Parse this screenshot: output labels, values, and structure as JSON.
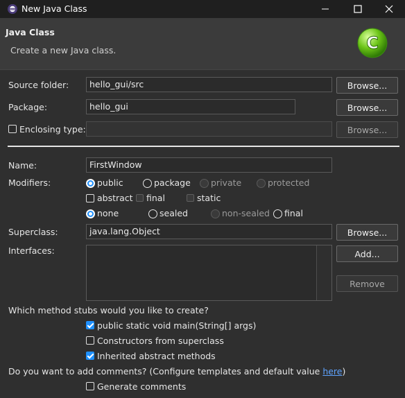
{
  "window": {
    "title": "New Java Class",
    "controls": {
      "minimize": "minimize-icon",
      "maximize": "maximize-icon",
      "close": "close-icon"
    }
  },
  "header": {
    "title": "Java Class",
    "description": "Create a new Java class.",
    "badge_letter": "C"
  },
  "source_folder": {
    "label": "Source folder:",
    "value": "hello_gui/src",
    "browse": "Browse..."
  },
  "package": {
    "label": "Package:",
    "value": "hello_gui",
    "browse": "Browse..."
  },
  "enclosing_type": {
    "label": "Enclosing type:",
    "value": "",
    "browse": "Browse...",
    "checked": false
  },
  "name": {
    "label": "Name:",
    "value": "FirstWindow"
  },
  "modifiers": {
    "label": "Modifiers:",
    "access": [
      "public",
      "package",
      "private",
      "protected"
    ],
    "access_selected": "public",
    "abstract": "abstract",
    "final": "final",
    "static": "static",
    "sealing": [
      "none",
      "sealed",
      "non-sealed",
      "final"
    ],
    "sealing_selected": "none"
  },
  "superclass": {
    "label": "Superclass:",
    "value": "java.lang.Object",
    "browse": "Browse..."
  },
  "interfaces": {
    "label": "Interfaces:",
    "add": "Add...",
    "remove": "Remove"
  },
  "stubs": {
    "question": "Which method stubs would you like to create?",
    "main": "public static void main(String[] args)",
    "main_checked": true,
    "constructors": "Constructors from superclass",
    "constructors_checked": false,
    "inherited": "Inherited abstract methods",
    "inherited_checked": true
  },
  "comments": {
    "question_prefix": "Do you want to add comments? (Configure templates and default value ",
    "link": "here",
    "question_suffix": ")",
    "generate": "Generate comments",
    "generate_checked": false
  },
  "colors": {
    "accent": "#1e90ff",
    "link": "#5ea3ff",
    "badge": "#6cc417"
  }
}
